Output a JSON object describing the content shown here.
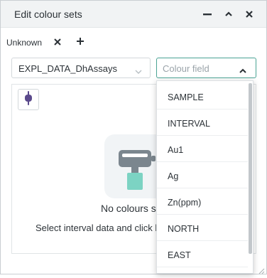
{
  "window": {
    "title": "Edit colour sets"
  },
  "titlebar_icons": [
    "minimize-icon",
    "collapse-icon",
    "close-icon"
  ],
  "tabs": [
    {
      "label": "Unknown"
    }
  ],
  "tab_icons": [
    "close-tab-icon",
    "add-tab-icon"
  ],
  "table_select": {
    "value": "EXPL_DATA_DhAssays"
  },
  "colour_field_select": {
    "placeholder": "Colour field"
  },
  "empty_state": {
    "title": "No colours s",
    "hint": "Select interval data and click h"
  },
  "dropdown": {
    "options": [
      "SAMPLE",
      "INTERVAL",
      "Au1",
      "Ag",
      "Zn(ppm)",
      "NORTH",
      "EAST"
    ]
  },
  "colors": {
    "accent": "#4aa394",
    "picker_icon": "#5b4a8c",
    "brush_teal": "#7cd3c3",
    "brush_grey": "#7b868e"
  }
}
